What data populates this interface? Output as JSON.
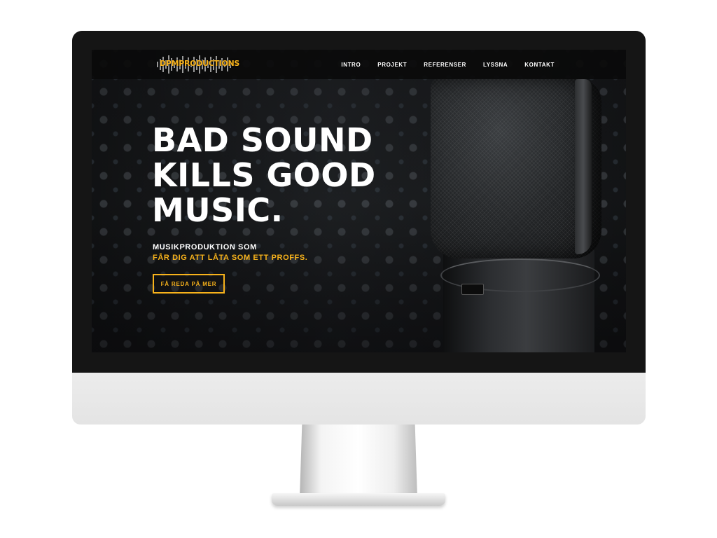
{
  "brand": {
    "logo_dpm": "DPM",
    "logo_productions": "PRODUCTIONS"
  },
  "nav": {
    "items": [
      {
        "label": "INTRO"
      },
      {
        "label": "PROJEKT"
      },
      {
        "label": "REFERENSER"
      },
      {
        "label": "LYSSNA"
      },
      {
        "label": "KONTAKT"
      }
    ]
  },
  "hero": {
    "title_line1": "BAD SOUND",
    "title_line2": "KILLS GOOD",
    "title_line3": "MUSIC.",
    "subtitle_line1": "MUSIKPRODUKTION SOM",
    "subtitle_line2": "FÅR DIG ATT LÅTA SOM ETT PROFFS.",
    "cta_label": "FÅ REDA PÅ MER"
  },
  "colors": {
    "accent": "#f7b21b",
    "text": "#ffffff",
    "nav_bg": "#0a0a0a",
    "monitor_bezel": "#151515",
    "monitor_chin": "#e8e8e8"
  },
  "icons": {
    "logo": "soundwave-logo-icon",
    "hero_image": "microphone-icon"
  }
}
